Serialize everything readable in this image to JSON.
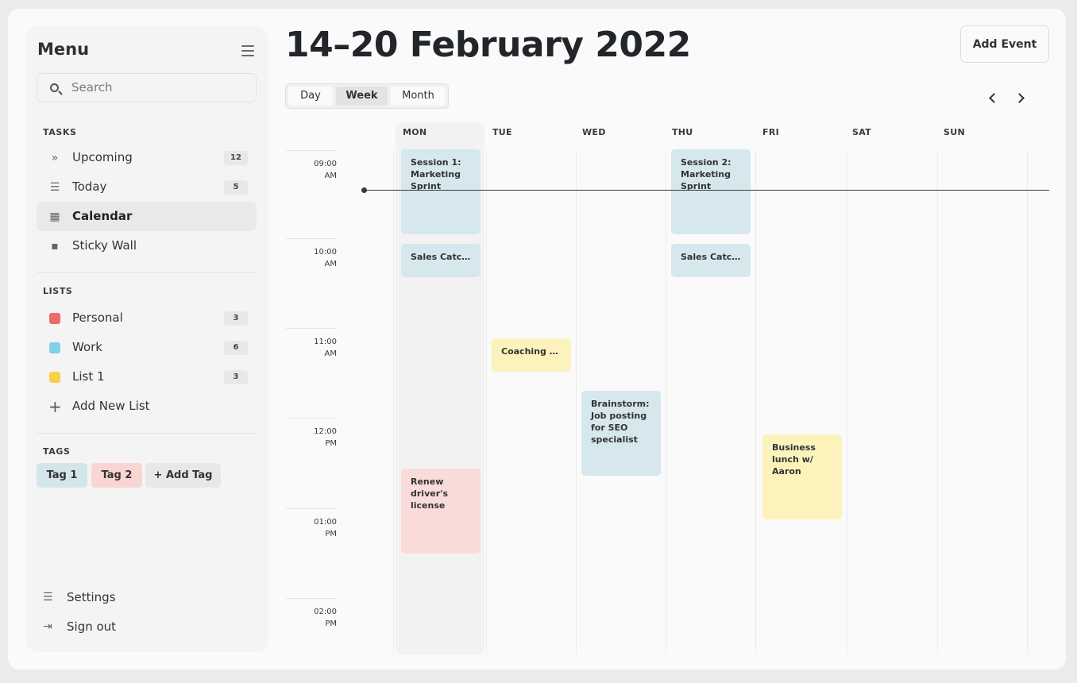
{
  "sidebar": {
    "title": "Menu",
    "search_placeholder": "Search",
    "tasks_label": "TASKS",
    "tasks": [
      {
        "label": "Upcoming",
        "count": "12",
        "icon": "double-chevron-right-icon"
      },
      {
        "label": "Today",
        "count": "5",
        "icon": "checklist-icon"
      },
      {
        "label": "Calendar",
        "icon": "calendar-icon",
        "active": true
      },
      {
        "label": "Sticky Wall",
        "icon": "sticky-note-icon"
      }
    ],
    "lists_label": "LISTS",
    "lists": [
      {
        "label": "Personal",
        "count": "3",
        "color": "#ee6b67"
      },
      {
        "label": "Work",
        "count": "6",
        "color": "#7fd0e8"
      },
      {
        "label": "List 1",
        "count": "3",
        "color": "#f8d14a"
      }
    ],
    "add_list": "Add New List",
    "tags_label": "TAGS",
    "tags": [
      {
        "label": "Tag 1",
        "color": "#d3e6ec"
      },
      {
        "label": "Tag 2",
        "color": "#f9d5d3"
      },
      {
        "label": "+ Add Tag",
        "color": "#e8e8e8"
      }
    ],
    "settings": "Settings",
    "sign_out": "Sign out"
  },
  "header": {
    "title": "14–20 February 2022",
    "add_event": "Add Event"
  },
  "views": [
    "Day",
    "Week",
    "Month"
  ],
  "active_view": "Week",
  "days": [
    "MON",
    "TUE",
    "WED",
    "THU",
    "FRI",
    "SAT",
    "SUN"
  ],
  "times": [
    {
      "h": "09:00",
      "p": "AM"
    },
    {
      "h": "10:00",
      "p": "AM"
    },
    {
      "h": "11:00",
      "p": "AM"
    },
    {
      "h": "12:00",
      "p": "PM"
    },
    {
      "h": "01:00",
      "p": "PM"
    },
    {
      "h": "02:00",
      "p": "PM"
    }
  ],
  "events": [
    {
      "title": "Session 1: Marketing Sprint",
      "day": "MON"
    },
    {
      "title": "Sales Catch...",
      "day": "MON"
    },
    {
      "title": "Renew driver's license",
      "day": "MON"
    },
    {
      "title": "Coaching s...",
      "day": "TUE"
    },
    {
      "title": "Brainstorm: Job posting for SEO specialist",
      "day": "WED"
    },
    {
      "title": "Session 2: Marketing Sprint",
      "day": "THU"
    },
    {
      "title": "Sales Catch...",
      "day": "THU"
    },
    {
      "title": "Business lunch w/ Aaron",
      "day": "FRI"
    }
  ],
  "colors": {
    "event_blue": "#d6e8ed",
    "event_yellow": "#fcf2bb",
    "event_pink": "#f9dbda"
  }
}
